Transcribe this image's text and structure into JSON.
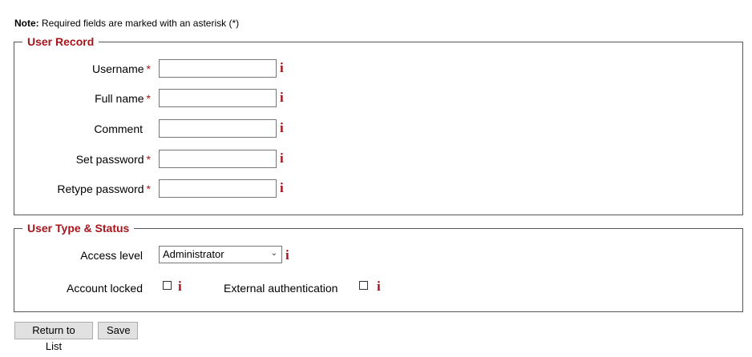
{
  "note": {
    "prefix": "Note:",
    "text": "Required fields are marked with an asterisk (*)"
  },
  "user_record": {
    "legend": "User Record",
    "fields": [
      {
        "label": "Username",
        "required": "*",
        "value": ""
      },
      {
        "label": "Full name",
        "required": "*",
        "value": ""
      },
      {
        "label": "Comment",
        "required": "",
        "value": ""
      },
      {
        "label": "Set password",
        "required": "*",
        "value": ""
      },
      {
        "label": "Retype password",
        "required": "*",
        "value": ""
      }
    ]
  },
  "user_type": {
    "legend": "User Type & Status",
    "access_level_label": "Access level",
    "access_level_value": "Administrator",
    "account_locked_label": "Account locked",
    "external_auth_label": "External authentication"
  },
  "info_glyph": "i",
  "buttons": {
    "return": "Return to List",
    "save": "Save"
  },
  "colors": {
    "accent": "#a8141b"
  }
}
